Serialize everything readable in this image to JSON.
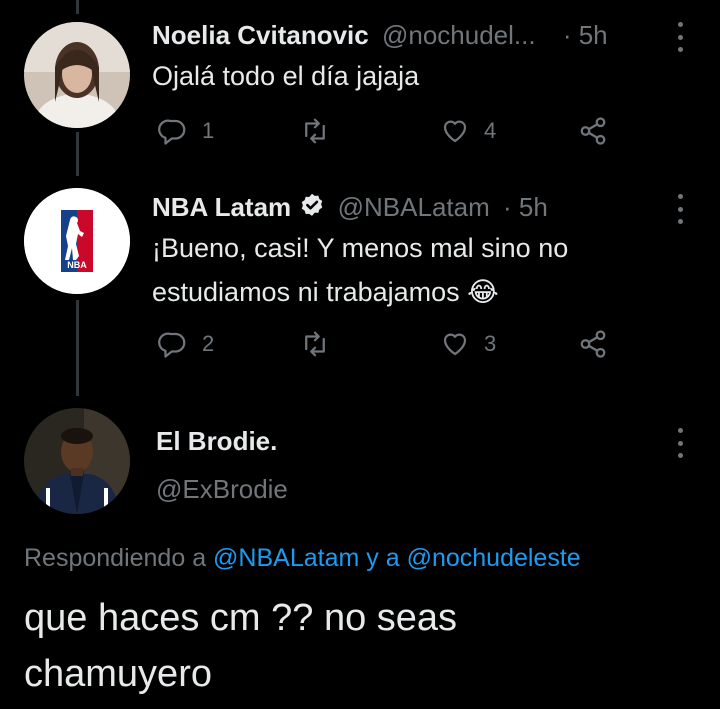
{
  "tweets": [
    {
      "name": "Noelia Cvitanovic",
      "handle": "@nochudel...",
      "sep": "·",
      "time": "5h",
      "text": "Ojalá todo el día jajaja",
      "replies": "1",
      "retweets": "",
      "likes": "4"
    },
    {
      "name": "NBA Latam",
      "handle": "@NBALatam",
      "sep": "·",
      "time": "5h",
      "text_line1": "¡Bueno, casi! Y menos mal sino no",
      "text_line2": "estudiamos ni trabajamos 😂",
      "replies": "2",
      "retweets": "",
      "likes": "3"
    }
  ],
  "main_tweet": {
    "name": "El Brodie.",
    "handle": "@ExBrodie",
    "replying_prefix": "Respondiendo a",
    "mention1": "@NBALatam",
    "and": "y a",
    "mention2": "@nochudeleste",
    "text": "que haces cm ?? no seas chamuyero"
  },
  "logo_text": "NBA",
  "colors": {
    "background": "#000000",
    "text": "#e7e9ea",
    "muted": "#71767b",
    "link": "#1d9bf0",
    "verified": "#e7e9ea"
  }
}
